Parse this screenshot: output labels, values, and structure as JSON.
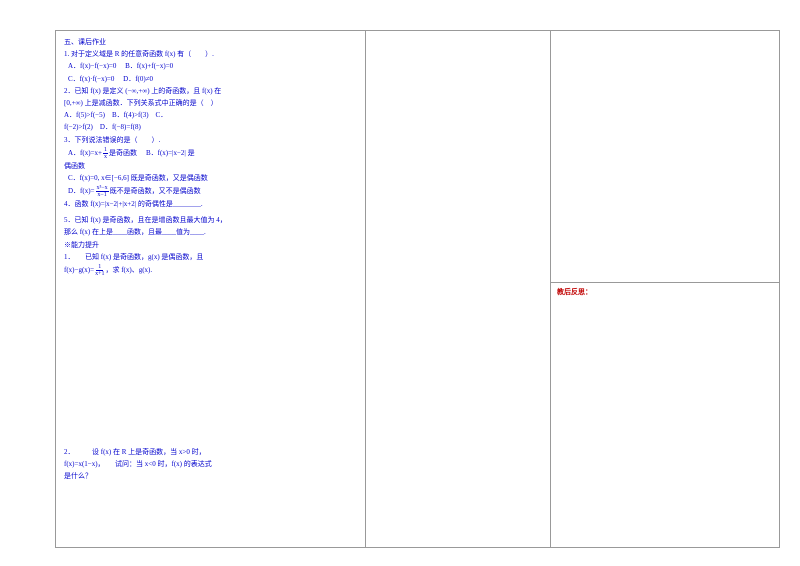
{
  "section_header": "五、课后作业",
  "q1": {
    "stem": "1. 对于定义域是 R 的任意奇函数 f(x) 有（　　）.",
    "a": "A．f(x)−f(−x)=0",
    "b": "B．f(x)+f(−x)=0",
    "c": "C．f(x)·f(−x)=0",
    "d": "D．f(0)≠0"
  },
  "q2": {
    "stem_a": "2．已知 f(x) 是定义 (−∞,+∞) 上的奇函数，且 f(x) 在",
    "stem_b": "[0,+∞) 上是减函数．下列关系式中正确的是（　）",
    "a": "A．f(5)>f(−5)",
    "b": "B．f(4)>f(3)",
    "c_line": "C．",
    "c2": "f(−2)>f(2)",
    "d": "D．f(−8)=f(8)"
  },
  "q3": {
    "stem": "3．下列说法错误的是（　　）.",
    "a_pre": "A．f(x)=x+",
    "a_frac_top": "1",
    "a_frac_bot": "x",
    "a_post": " 是奇函数",
    "b": "B．f(x)=|x−2| 是",
    "b_cont": "偶函数",
    "c": "C．f(x)=0, x∈[−6,6] 既是奇函数，又是偶函数",
    "d_pre": "D．f(x)=",
    "d_frac_top": "x³−x",
    "d_frac_bot": "x−1",
    "d_post": " 既不是奇函数，又不是偶函数"
  },
  "q4": "4．函数 f(x)=|x−2|+|x+2| 的奇偶性是________.",
  "q5_a": "5．已知 f(x) 是奇函数，且在是增函数且最大值为 4，",
  "q5_b": "那么 f(x) 在上是____函数，且最____值为____.",
  "power_header": "※能力提升",
  "p1_a": "1．　　已知 f(x) 是奇函数，g(x) 是偶函数，且",
  "p1_eq_pre": "f(x)−g(x)=",
  "p1_frac_top": "1",
  "p1_frac_bot": "x+1",
  "p1_eq_post": "，求 f(x)、g(x).",
  "p2_a": "2．　　　设 f(x) 在 R 上是奇函数，当 x>0 时，",
  "p2_b": "f(x)=x(1−x)，　　试问：当 x<0 时，f(x) 的表达式",
  "p2_c": "是什么？",
  "reflection": "教后反思："
}
